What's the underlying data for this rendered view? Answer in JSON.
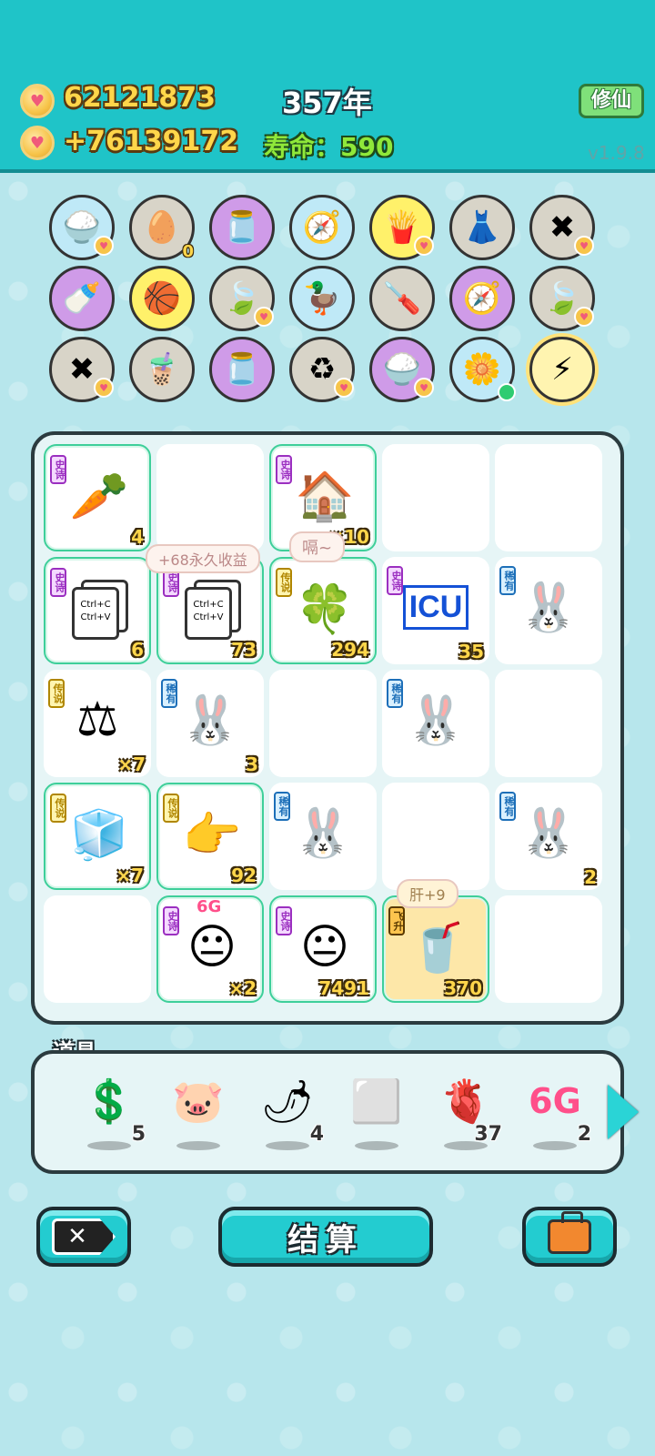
{
  "header": {
    "coins": "62121873",
    "income": "+76139172",
    "year": "357年",
    "lifespan": "寿命：590",
    "xiuxian_button": "修仙",
    "version": "v1.9.8"
  },
  "top_items": [
    {
      "icon": "rice-bowl",
      "glyph": "🍚",
      "bg": "blue",
      "heart": true
    },
    {
      "icon": "egg-tray",
      "glyph": "🥚",
      "bg": "gray",
      "count": "0"
    },
    {
      "icon": "jar",
      "glyph": "🫙",
      "bg": "purple"
    },
    {
      "icon": "compass",
      "glyph": "🧭",
      "bg": "blue"
    },
    {
      "icon": "fries",
      "glyph": "🍟",
      "bg": "yellow",
      "heart": true
    },
    {
      "icon": "skirt",
      "glyph": "👗",
      "bg": "gray"
    },
    {
      "icon": "tag-x",
      "glyph": "✖",
      "bg": "gray",
      "heart": true
    },
    {
      "icon": "breast-pump",
      "glyph": "🍼",
      "bg": "purple"
    },
    {
      "icon": "basketballs",
      "glyph": "🏀",
      "bg": "yellow"
    },
    {
      "icon": "leaf",
      "glyph": "🍃",
      "bg": "gray",
      "heart": true
    },
    {
      "icon": "duck-pot",
      "glyph": "🦆",
      "bg": "blue"
    },
    {
      "icon": "screwdriver",
      "glyph": "🪛",
      "bg": "gray"
    },
    {
      "icon": "compass",
      "glyph": "🧭",
      "bg": "purple"
    },
    {
      "icon": "leaf",
      "glyph": "🍃",
      "bg": "gray",
      "heart": true
    },
    {
      "icon": "tag-x",
      "glyph": "✖",
      "bg": "gray",
      "heart": true
    },
    {
      "icon": "bubble-tea",
      "glyph": "🧋",
      "bg": "gray"
    },
    {
      "icon": "jar",
      "glyph": "🫙",
      "bg": "purple"
    },
    {
      "icon": "recycle",
      "glyph": "♻",
      "bg": "gray",
      "heart": true
    },
    {
      "icon": "rice-bowl",
      "glyph": "🍚",
      "bg": "purple",
      "heart": true
    },
    {
      "icon": "flower-pot",
      "glyph": "🌼",
      "bg": "blue",
      "dot": true
    },
    {
      "icon": "lightning",
      "glyph": "⚡",
      "bg": "glow"
    }
  ],
  "board": {
    "cells": [
      {
        "tag": "史诗",
        "tag_type": "epic",
        "icon": "carrot",
        "glyph": "🥕",
        "count": "4"
      },
      {},
      {
        "tag": "史诗",
        "tag_type": "epic",
        "icon": "rabbit-house",
        "glyph": "🏠",
        "count": "×10"
      },
      {},
      {},
      {
        "tag": "史诗",
        "tag_type": "epic",
        "icon": "ctrl-copy",
        "copy": true,
        "count": "6"
      },
      {
        "tag": "史诗",
        "tag_type": "epic",
        "icon": "ctrl-copy",
        "copy": true,
        "count": "73"
      },
      {
        "tag": "传说",
        "tag_type": "legend",
        "icon": "clover-fridge",
        "glyph": "🍀",
        "count": "294"
      },
      {
        "tag": "史诗",
        "tag_type": "epic",
        "icon": "icu",
        "icu": true,
        "count": "35",
        "plain": true
      },
      {
        "tag": "稀有",
        "tag_type": "rare",
        "icon": "rabbit",
        "glyph": "🐰",
        "plain": true
      },
      {
        "tag": "传说",
        "tag_type": "legend",
        "icon": "scale",
        "glyph": "⚖",
        "count": "×7",
        "plain": true
      },
      {
        "tag": "稀有",
        "tag_type": "rare",
        "icon": "rabbit",
        "glyph": "🐰",
        "count": "3",
        "plain": true
      },
      {},
      {
        "tag": "稀有",
        "tag_type": "rare",
        "icon": "rabbit",
        "glyph": "🐰",
        "plain": true
      },
      {},
      {
        "tag": "传说",
        "tag_type": "legend",
        "icon": "fridge",
        "glyph": "🧊",
        "count": "×7"
      },
      {
        "tag": "传说",
        "tag_type": "legend",
        "icon": "crown-hand",
        "glyph": "👉",
        "count": "92"
      },
      {
        "tag": "稀有",
        "tag_type": "rare",
        "icon": "rabbit",
        "glyph": "🐰",
        "plain": true
      },
      {},
      {
        "tag": "稀有",
        "tag_type": "rare",
        "icon": "rabbit",
        "glyph": "🐰",
        "count": "2",
        "plain": true
      },
      {},
      {
        "tag": "史诗",
        "tag_type": "epic",
        "icon": "face-6g",
        "glyph": "😐",
        "count": "×2"
      },
      {
        "tag": "史诗",
        "tag_type": "epic",
        "icon": "face",
        "glyph": "😐",
        "count": "7491"
      },
      {
        "tag": "飞升",
        "tag_type": "fly",
        "icon": "bubble-tea-cup",
        "glyph": "🥤",
        "count": "370",
        "gold": true
      },
      {}
    ],
    "bubble_income": "+68永久收益",
    "bubble_sound": "嗝~",
    "bubble_liver": "肝+9",
    "label_6g": "6G",
    "copy_text_1": "Ctrl+C",
    "copy_text_2": "Ctrl+V",
    "icu_text": "ICU"
  },
  "props": {
    "title": "道具",
    "items": [
      {
        "icon": "dollar-coin",
        "glyph": "💲",
        "count": "5"
      },
      {
        "icon": "piggy-bank",
        "glyph": "🐷",
        "count": ""
      },
      {
        "icon": "chili",
        "glyph": "🌶",
        "count": "4"
      },
      {
        "icon": "frame",
        "glyph": "⬜",
        "count": ""
      },
      {
        "icon": "liver",
        "glyph": "🫀",
        "count": "37"
      },
      {
        "icon": "6g",
        "glyph": "6G",
        "count": "2"
      }
    ]
  },
  "buttons": {
    "settle": "结算"
  }
}
